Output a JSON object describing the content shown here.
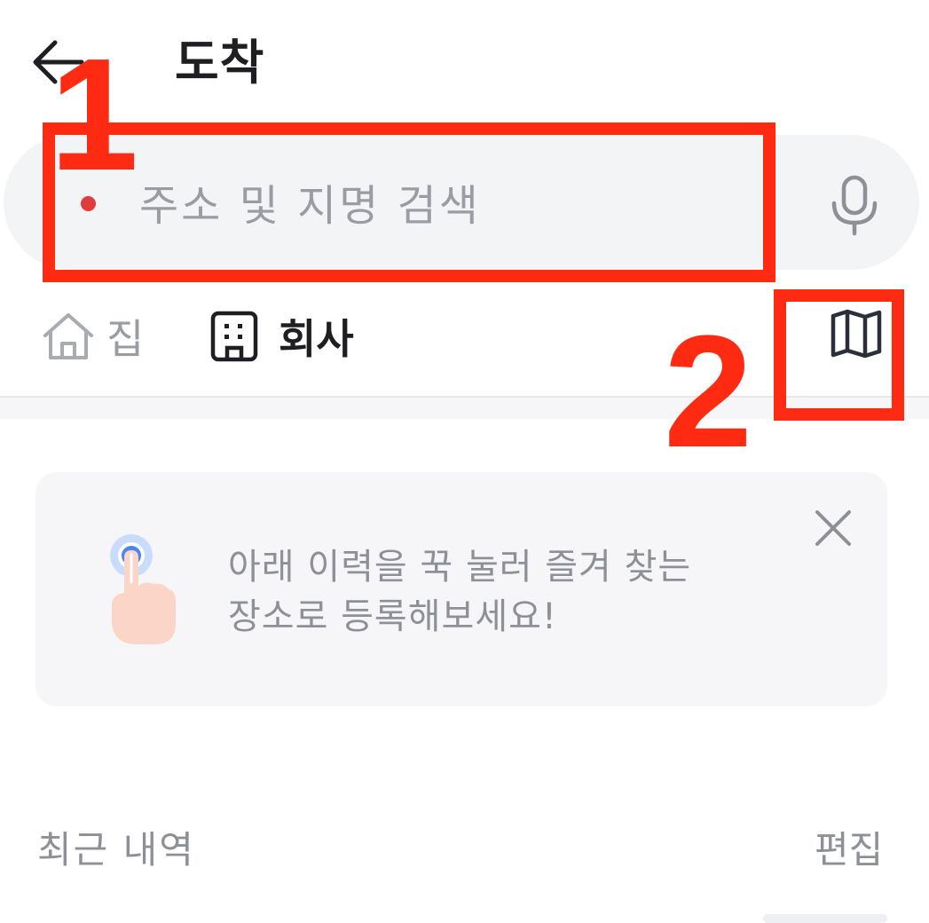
{
  "header": {
    "back_icon": "arrow-left-icon",
    "title": "도착"
  },
  "search": {
    "placeholder": "주소 및 지명 검색",
    "value": "",
    "dot_icon": "destination-dot-icon",
    "dot_color": "#e23b3b",
    "mic_icon": "microphone-icon"
  },
  "shortcuts": {
    "home": {
      "icon": "home-icon",
      "label": "집"
    },
    "company": {
      "icon": "building-icon",
      "label": "회사"
    },
    "map_icon": "map-icon"
  },
  "tip": {
    "icon": "tap-finger-icon",
    "line1": "아래 이력을 꾹 눌러 즐겨 찾는",
    "line2": "장소로 등록해보세요!",
    "close_icon": "close-icon"
  },
  "recent": {
    "title": "최근 내역",
    "edit_label": "편집"
  },
  "annotations": {
    "marker_1": "1",
    "marker_2": "2",
    "color": "#ff2a12"
  }
}
